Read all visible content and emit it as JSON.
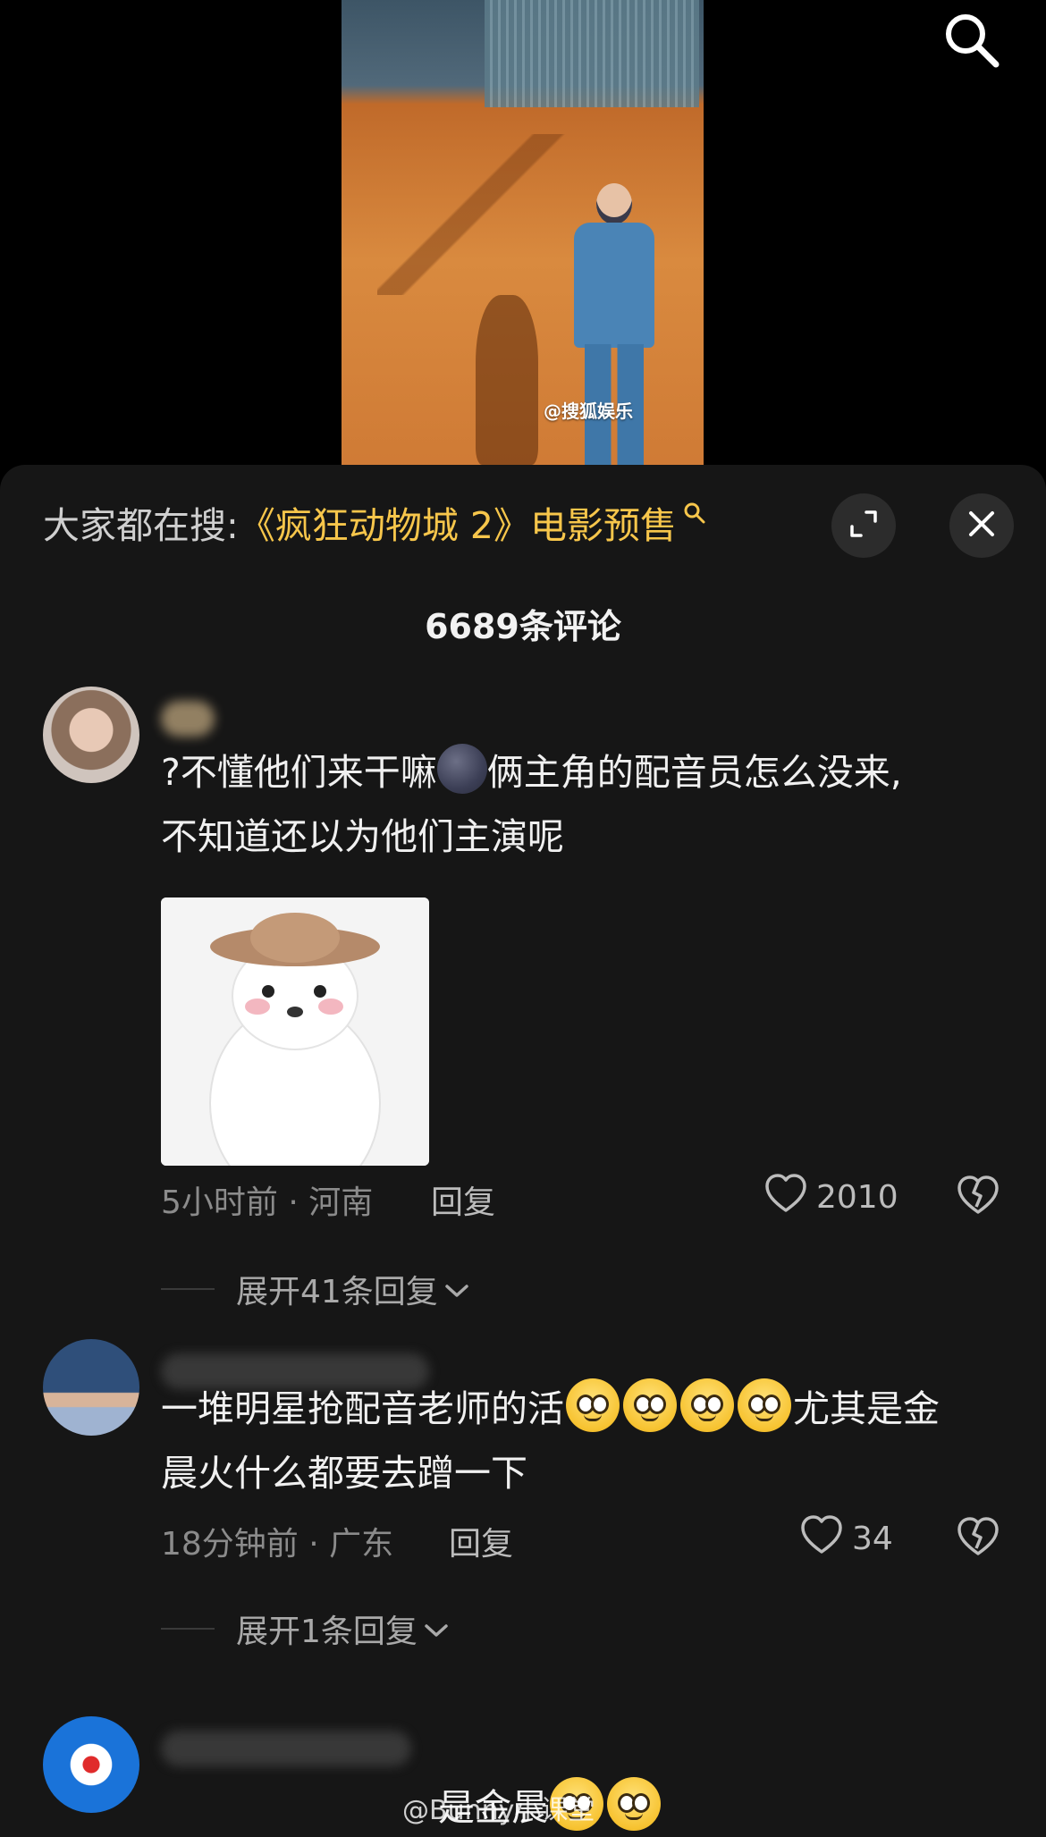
{
  "video": {
    "watermark": "@搜狐娱乐"
  },
  "top_bar": {
    "search_icon": "search-icon"
  },
  "sheet": {
    "trend_prefix": "大家都在搜:",
    "trend_keyword": "《疯狂动物城 2》电影预售",
    "expand_icon": "expand-icon",
    "close_icon": "close-icon",
    "comment_count": "6689条评论"
  },
  "comments": [
    {
      "text_1": "?不懂他们来干嘛",
      "text_2": "俩主角的配音员怎么没来,",
      "text_3": "不知道还以为他们主演呢",
      "meta": "5小时前 · 河南",
      "reply_label": "回复",
      "likes": "2010",
      "expand_replies": "展开41条回复"
    },
    {
      "text_1": "一堆明星抢配音老师的活",
      "text_2": "尤其是金",
      "text_3": "晨火什么都要去蹭一下",
      "meta": "18分钟前 · 广东",
      "reply_label": "回复",
      "likes": "34",
      "expand_replies": "展开1条回复"
    },
    {
      "text_partial": "是金晨"
    }
  ],
  "footer_watermark": "@Bunny小课堂",
  "colors": {
    "background": "#161616",
    "keyword": "#f7c64b",
    "muted": "#8b8b8b"
  }
}
